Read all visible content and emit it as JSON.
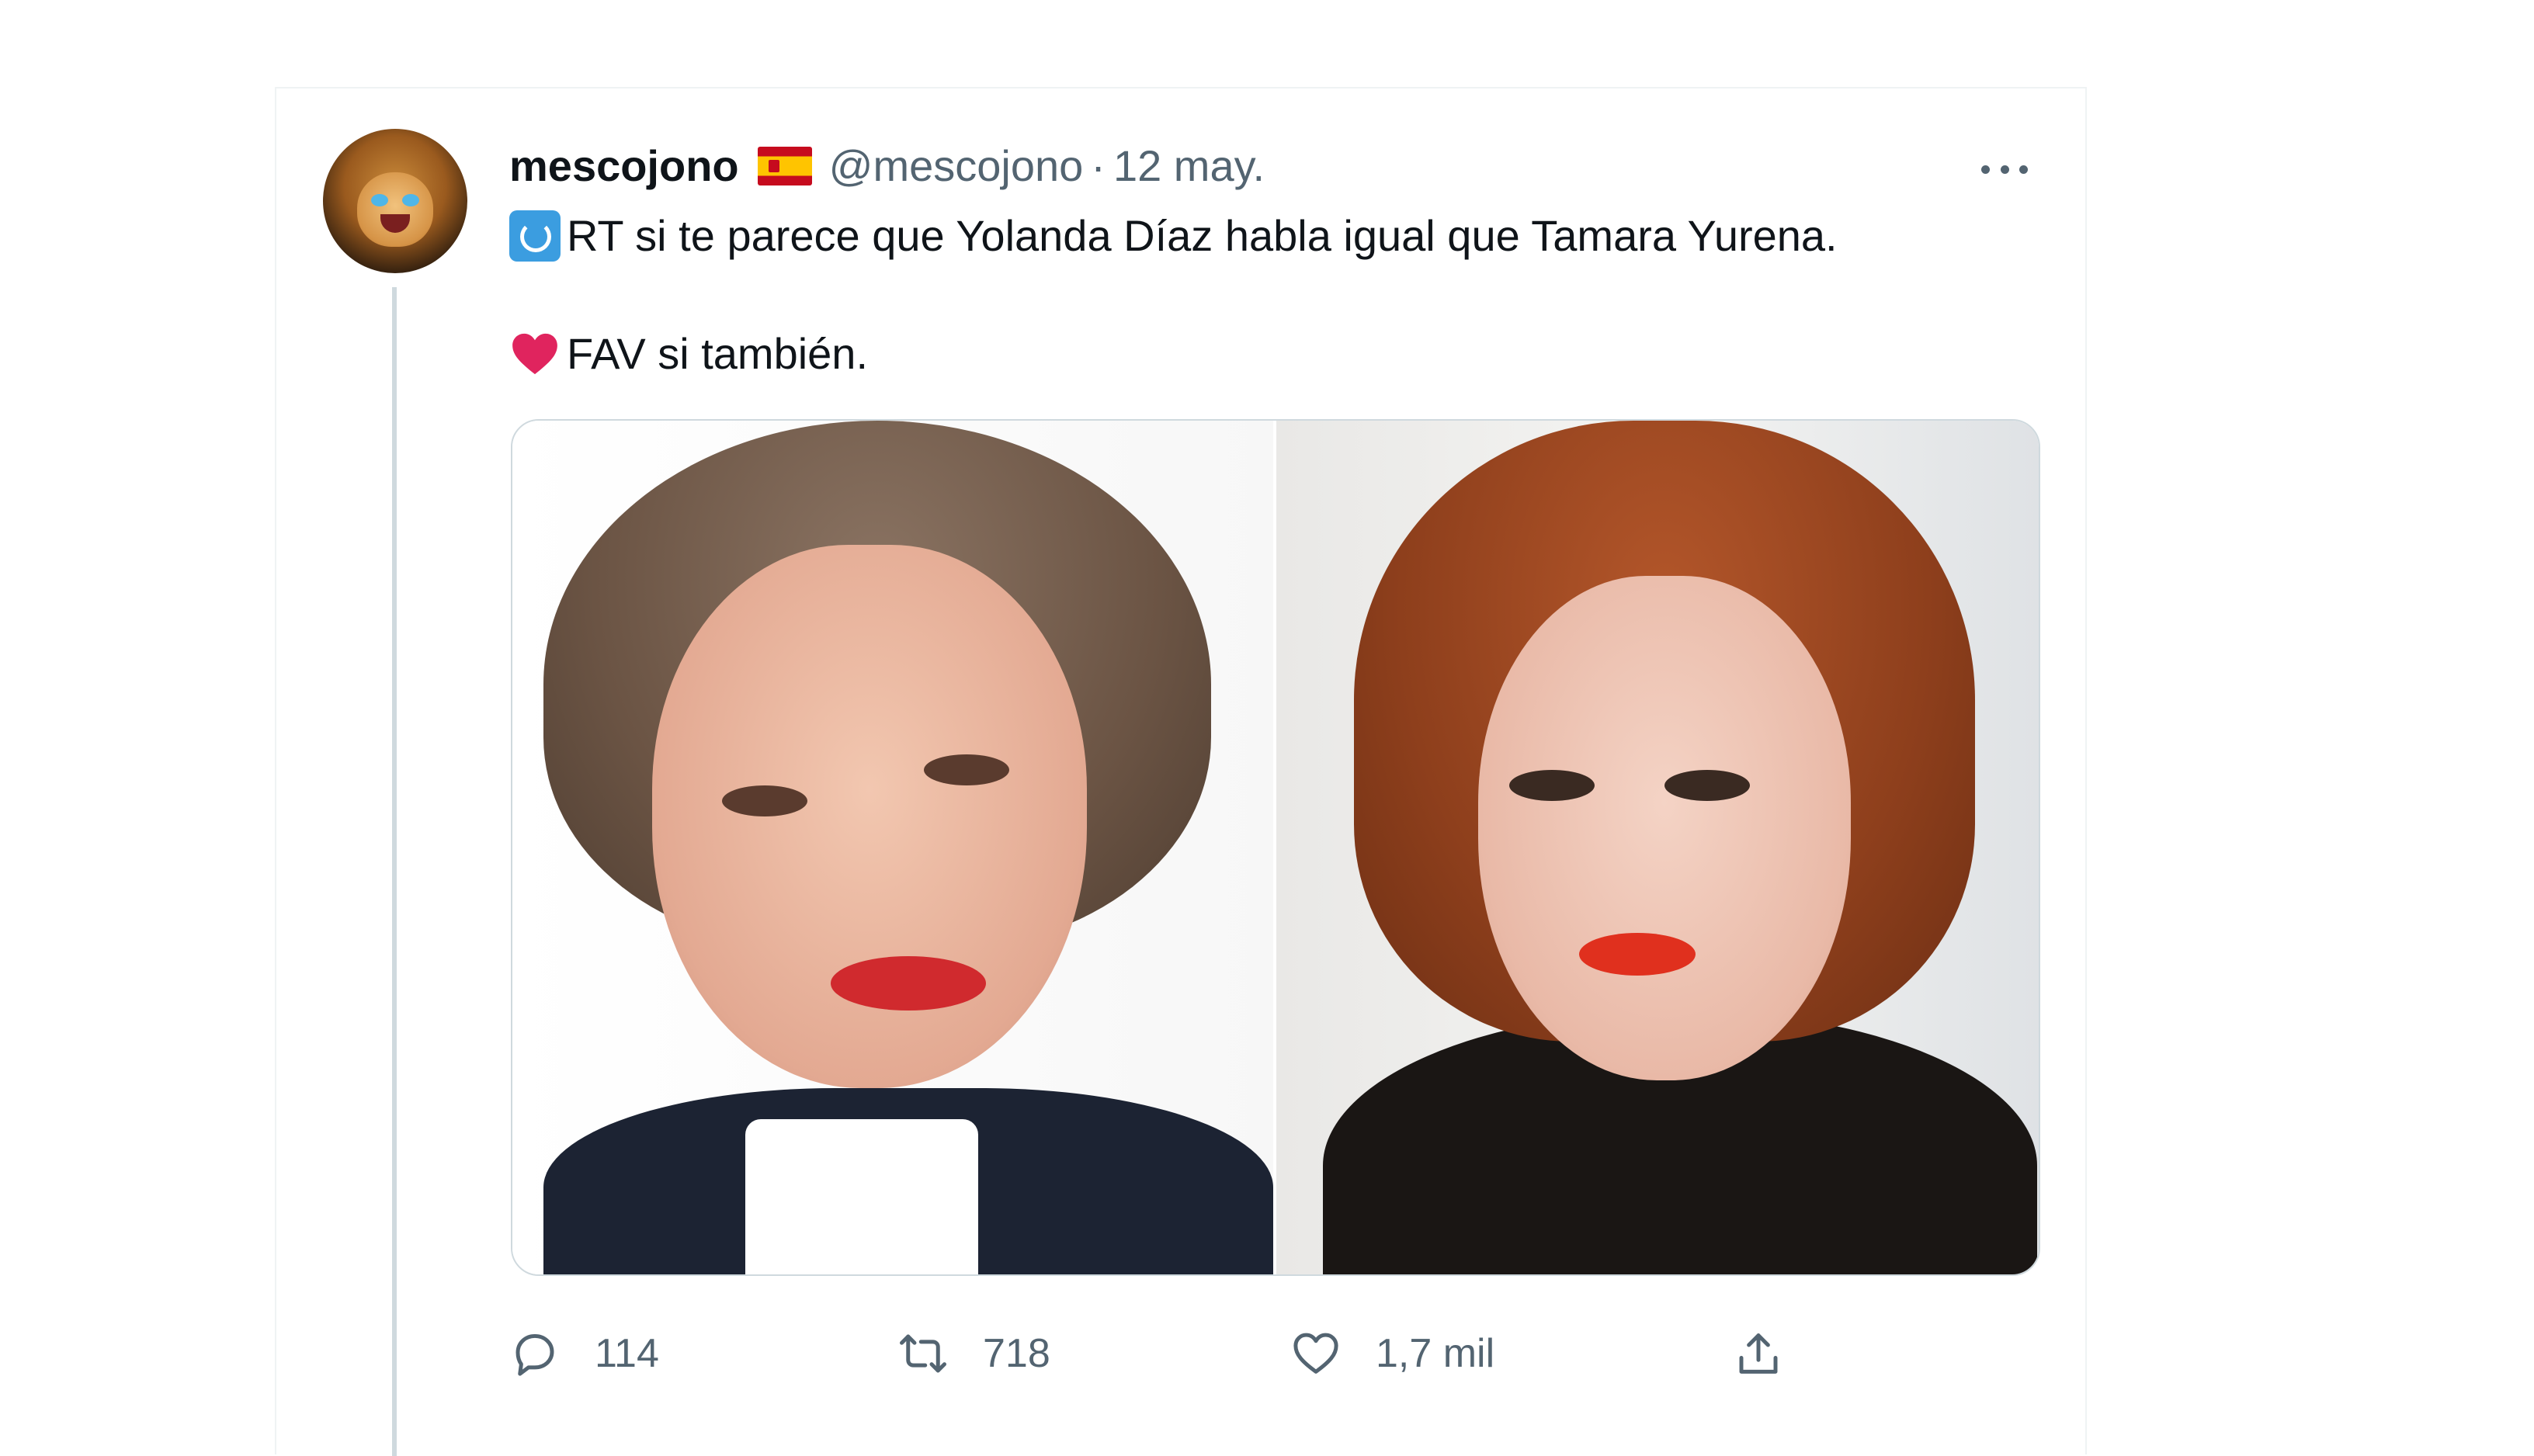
{
  "tweet": {
    "display_name": "mescojono",
    "flag_icon": "spain-flag-icon",
    "handle": "@mescojono",
    "separator": "·",
    "date": "12 may.",
    "text_line_1": "RT si te parece que Yolanda Díaz habla igual que Tamara Yurena.",
    "text_line_2": "FAV si también.",
    "line_1_emoji": "retweet-emoji-icon",
    "line_2_emoji": "red-heart-emoji-icon"
  },
  "actions": {
    "replies": "114",
    "retweets": "718",
    "likes": "1,7 mil"
  },
  "colors": {
    "text_primary": "#0f1419",
    "text_secondary": "#536471",
    "border": "#eff3f4",
    "heart": "#e0245e"
  }
}
